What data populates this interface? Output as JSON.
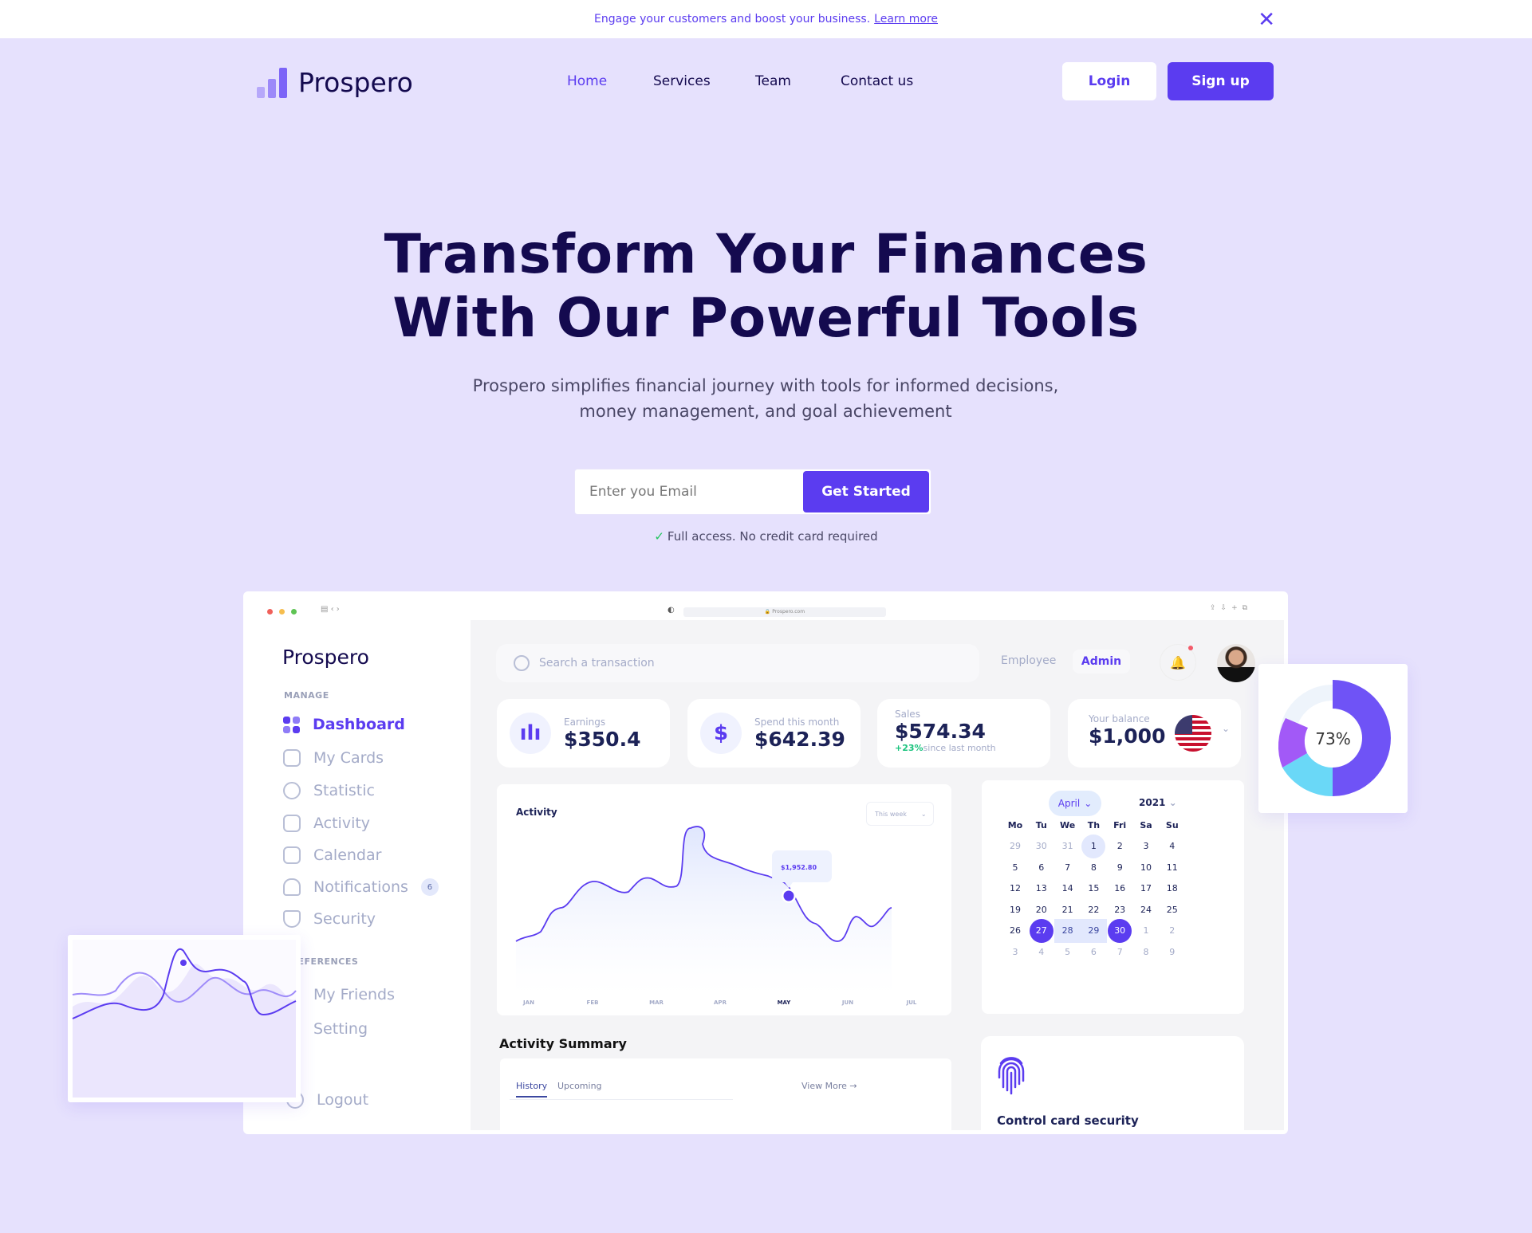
{
  "banner": {
    "text": "Engage your customers and boost your business.",
    "link": "Learn more"
  },
  "nav": {
    "brand": "Prospero",
    "links": [
      "Home",
      "Services",
      "Team",
      "Contact us"
    ],
    "login": "Login",
    "signup": "Sign up",
    "active": "Home"
  },
  "hero": {
    "title_line1": "Transform Your Finances",
    "title_line2": "With Our Powerful Tools",
    "subtitle_line1": "Prospero simplifies financial journey with tools for informed decisions,",
    "subtitle_line2": "money management, and goal achievement",
    "email_placeholder": "Enter you Email",
    "cta": "Get Started",
    "note": "Full access. No credit card required"
  },
  "colors": {
    "accent": "#5b3cf0",
    "background": "#e6e1fd",
    "heading": "#140a4f",
    "positive": "#22c55e"
  },
  "dashboard": {
    "url": "Prospero.com",
    "brand": "Prospero",
    "sidebar": {
      "manage_label": "MANAGE",
      "items": [
        "Dashboard",
        "My Cards",
        "Statistic",
        "Activity",
        "Calendar",
        "Notifications",
        "Security"
      ],
      "notifications_count": "6",
      "preferences_label": "PREFERENCES",
      "pref_items": [
        "My Friends",
        "Setting"
      ],
      "logout": "Logout"
    },
    "search_placeholder": "Search a transaction",
    "roles": [
      "Employee",
      "Admin"
    ],
    "stats": [
      {
        "label": "Earnings",
        "value": "$350.4"
      },
      {
        "label": "Spend this month",
        "value": "$642.39"
      },
      {
        "label": "Sales",
        "value": "$574.34",
        "change": "+23%",
        "change_note": "since last month"
      },
      {
        "label": "Your balance",
        "value": "$1,000"
      }
    ],
    "activity": {
      "title": "Activity",
      "filter": "This week",
      "months": [
        "JAN",
        "FEB",
        "MAR",
        "APR",
        "MAY",
        "JUN",
        "JUL"
      ],
      "active_month": "MAY",
      "tooltip": "$1,952.80"
    },
    "calendar": {
      "month": "April",
      "year": "2021",
      "weekdays": [
        "Mo",
        "Tu",
        "We",
        "Th",
        "Fri",
        "Sa",
        "Su"
      ],
      "days": [
        [
          "29",
          "30",
          "31",
          "1",
          "2",
          "3",
          "4"
        ],
        [
          "5",
          "6",
          "7",
          "8",
          "9",
          "10",
          "11"
        ],
        [
          "12",
          "13",
          "14",
          "15",
          "16",
          "17",
          "18"
        ],
        [
          "19",
          "20",
          "21",
          "22",
          "23",
          "24",
          "25"
        ],
        [
          "26",
          "27",
          "28",
          "29",
          "30",
          "1",
          "2"
        ],
        [
          "3",
          "4",
          "5",
          "6",
          "7",
          "8",
          "9"
        ]
      ]
    },
    "summary": {
      "title": "Activity Summary",
      "tabs": [
        "History",
        "Upcoming"
      ],
      "view_more": "View More →"
    },
    "security_card": {
      "title": "Control card security"
    },
    "donut": {
      "label": "73%",
      "percent": 73
    }
  }
}
